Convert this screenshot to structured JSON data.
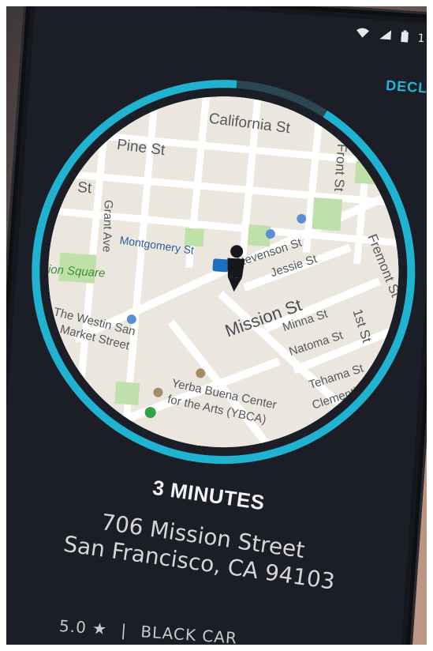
{
  "status_bar": {
    "wifi_icon": "wifi-icon",
    "signal_icon": "signal-icon",
    "battery_icon": "battery-icon",
    "partial_text": "1"
  },
  "header": {
    "decline_label": "DECLI"
  },
  "ring": {
    "accent": "#1fb3d1",
    "track": "#2b4552",
    "progress_fraction": 0.92
  },
  "map": {
    "streets": [
      "California St",
      "Pine St",
      "Front St",
      "Bush St",
      "Grant Ave",
      "Montgomery St",
      "Stevenson St",
      "Jessie St",
      "Fremont St",
      "Union Square",
      "Mission St",
      "Minna St",
      "1st St",
      "Natoma St",
      "The Westin San",
      "Market Street",
      "Tehama St",
      "Yerba Buena Center",
      "for the Arts (YBCA)",
      "Clementina"
    ],
    "visible_partial": {
      "bush": "St",
      "union": "ion Square",
      "clementina": "Clementin"
    }
  },
  "trip": {
    "eta": "3 MINUTES",
    "address_line1": "706 Mission Street",
    "address_line2": "San Francisco, CA 94103",
    "rating": "5.0 ★",
    "separator": "|",
    "car_type": "BLACK CAR"
  }
}
